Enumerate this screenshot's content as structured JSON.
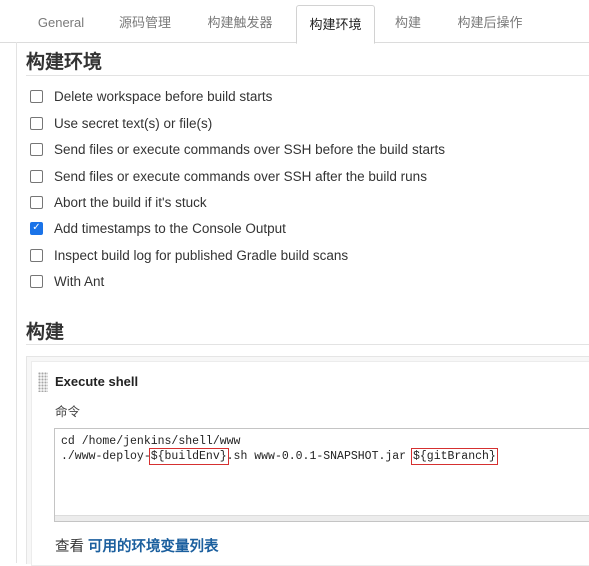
{
  "tabs": [
    {
      "label": "General",
      "active": false
    },
    {
      "label": "源码管理",
      "active": false
    },
    {
      "label": "构建触发器",
      "active": false
    },
    {
      "label": "构建环境",
      "active": true
    },
    {
      "label": "构建",
      "active": false
    },
    {
      "label": "构建后操作",
      "active": false
    }
  ],
  "build_env": {
    "title": "构建环境",
    "options": [
      {
        "label": "Delete workspace before build starts",
        "checked": false
      },
      {
        "label": "Use secret text(s) or file(s)",
        "checked": false
      },
      {
        "label": "Send files or execute commands over SSH before the build starts",
        "checked": false
      },
      {
        "label": "Send files or execute commands over SSH after the build runs",
        "checked": false
      },
      {
        "label": "Abort the build if it's stuck",
        "checked": false
      },
      {
        "label": "Add timestamps to the Console Output",
        "checked": true
      },
      {
        "label": "Inspect build log for published Gradle build scans",
        "checked": false
      },
      {
        "label": "With Ant",
        "checked": false
      }
    ]
  },
  "build": {
    "title": "构建",
    "step": {
      "title": "Execute shell",
      "command_label": "命令",
      "line1": "cd /home/jenkins/shell/www",
      "line2_prefix": "./www-deploy-",
      "line2_var1": "${buildEnv}",
      "line2_middle": ".sh www-0.0.1-SNAPSHOT.jar ",
      "line2_var2": "${gitBranch}"
    },
    "footer_prefix": "查看",
    "footer_link": "可用的环境变量列表"
  },
  "colors": {
    "accent": "#1a73e8",
    "link": "#1b5f9e",
    "highlight_border": "#d53030"
  }
}
